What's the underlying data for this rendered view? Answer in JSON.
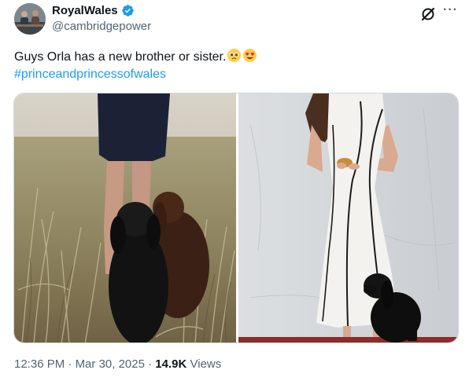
{
  "tweet": {
    "display_name": "RoyalWales",
    "handle": "@cambridgepower",
    "text": "Guys Orla has a new brother or sister.",
    "hashtag": "#princeandprincessofwales",
    "time": "12:36 PM",
    "separator": "·",
    "date": "Mar 30, 2025",
    "views_count": "14.9K",
    "views_label": "Views",
    "more_label": "···"
  },
  "icons": {
    "verified": "verified-badge-icon",
    "grok": "grok-icon",
    "more": "more-icon",
    "emoji_1": "pleading-face-emoji",
    "emoji_2": "heart-eyes-emoji"
  },
  "colors": {
    "verified": "#1d9bf0",
    "link": "#1d9bf0",
    "secondary_text": "#536471",
    "primary_text": "#0f1419",
    "border": "#cfd9de"
  }
}
